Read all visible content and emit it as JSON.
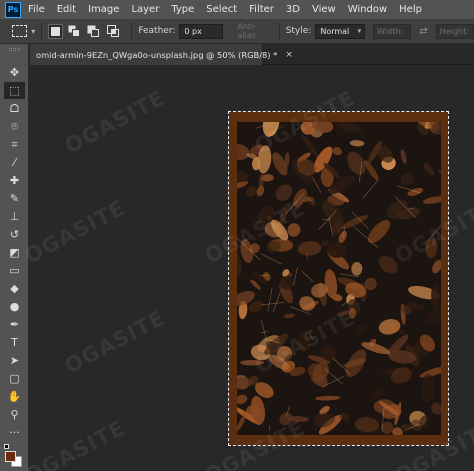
{
  "app": {
    "logo": "Ps",
    "menu": [
      "File",
      "Edit",
      "Image",
      "Layer",
      "Type",
      "Select",
      "Filter",
      "3D",
      "View",
      "Window",
      "Help"
    ]
  },
  "options": {
    "feather_label": "Feather:",
    "feather_value": "0 px",
    "antialias_label": "Anti-alias",
    "style_label": "Style:",
    "style_value": "Normal",
    "width_label": "Width:",
    "height_label": "Height:"
  },
  "document": {
    "tab_title": "omid-armin-9EZn_QWga0o-unsplash.jpg @ 50% (RGB/8) *",
    "close_glyph": "×"
  },
  "tools": [
    {
      "name": "move-tool",
      "glyph": "✥"
    },
    {
      "name": "rectangular-marquee-tool",
      "glyph": "⬚",
      "active": true
    },
    {
      "name": "lasso-tool",
      "glyph": "ᗝ"
    },
    {
      "name": "quick-selection-tool",
      "glyph": "⌾"
    },
    {
      "name": "crop-tool",
      "glyph": "⌗"
    },
    {
      "name": "eyedropper-tool",
      "glyph": "⁄"
    },
    {
      "name": "healing-brush-tool",
      "glyph": "✚"
    },
    {
      "name": "brush-tool",
      "glyph": "✎"
    },
    {
      "name": "clone-stamp-tool",
      "glyph": "⊥"
    },
    {
      "name": "history-brush-tool",
      "glyph": "↺"
    },
    {
      "name": "eraser-tool",
      "glyph": "◩"
    },
    {
      "name": "gradient-tool",
      "glyph": "▭"
    },
    {
      "name": "blur-tool",
      "glyph": "◆"
    },
    {
      "name": "dodge-tool",
      "glyph": "●"
    },
    {
      "name": "pen-tool",
      "glyph": "✒"
    },
    {
      "name": "type-tool",
      "glyph": "T"
    },
    {
      "name": "path-selection-tool",
      "glyph": "➤"
    },
    {
      "name": "rectangle-tool",
      "glyph": "▢"
    },
    {
      "name": "hand-tool",
      "glyph": "✋"
    },
    {
      "name": "zoom-tool",
      "glyph": "⚲"
    },
    {
      "name": "more-tools",
      "glyph": "···"
    }
  ],
  "colors": {
    "foreground": "#6e2a0d",
    "background": "#ffffff"
  },
  "watermark": "OGASITE"
}
